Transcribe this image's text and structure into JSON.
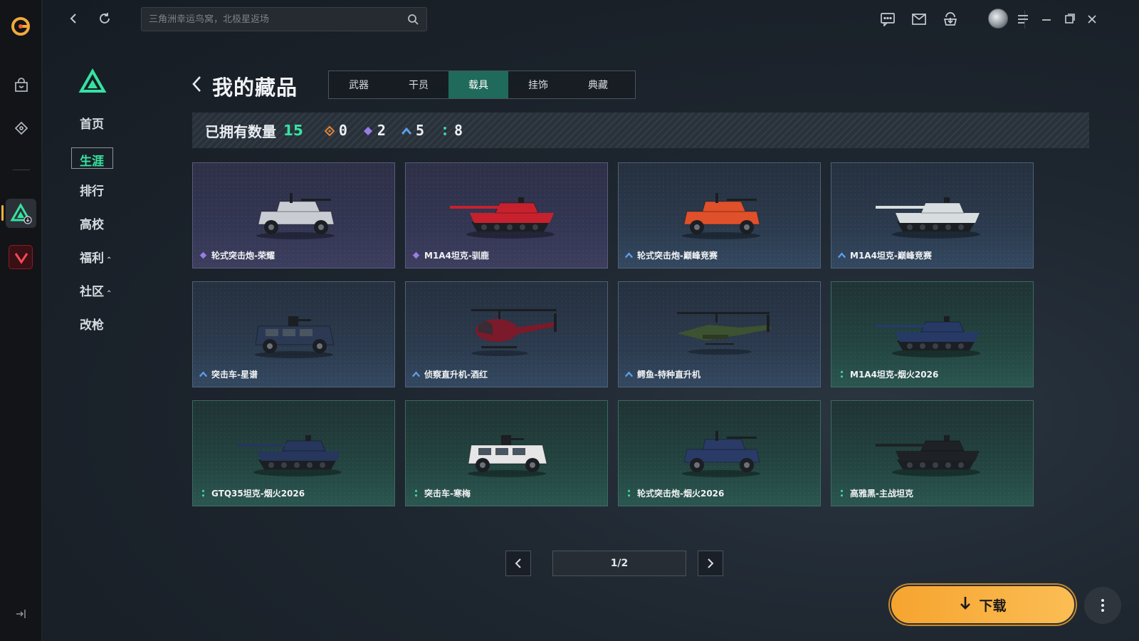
{
  "search": {
    "placeholder": "三角洲幸运鸟窝，北极星返场"
  },
  "game_nav": {
    "items": [
      {
        "label": "首页",
        "caret": ""
      },
      {
        "label": "生涯",
        "caret": ""
      },
      {
        "label": "排行",
        "caret": ""
      },
      {
        "label": "高校",
        "caret": ""
      },
      {
        "label": "福利",
        "caret": "⌃"
      },
      {
        "label": "社区",
        "caret": "⌃"
      },
      {
        "label": "改枪",
        "caret": ""
      }
    ],
    "active_index": 1
  },
  "page": {
    "title": "我的藏品",
    "tabs": [
      "武器",
      "干员",
      "载具",
      "挂饰",
      "典藏"
    ],
    "active_tab": 2
  },
  "owned": {
    "label": "已拥有数量",
    "count": "15",
    "rarities": [
      {
        "icon": "orange-diamond-icon",
        "color": "#e0843a",
        "value": "0"
      },
      {
        "icon": "purple-diamond-icon",
        "color": "#9a7be8",
        "value": "2"
      },
      {
        "icon": "blue-chevron-icon",
        "color": "#5d9ee8",
        "value": "5"
      },
      {
        "icon": "green-dots-icon",
        "color": "#3fd4a0",
        "value": "8"
      }
    ]
  },
  "cards": [
    {
      "name": "轮式突击炮-荣耀",
      "rarity": "purple",
      "vehicle": "wheeled-gun-icon",
      "body_color": "#c9ccd2"
    },
    {
      "name": "M1A4坦克-驯鹿",
      "rarity": "purple",
      "vehicle": "tank-icon",
      "body_color": "#c8212e"
    },
    {
      "name": "轮式突击炮-巅峰竞赛",
      "rarity": "blue",
      "vehicle": "wheeled-gun-icon",
      "body_color": "#e0502a"
    },
    {
      "name": "M1A4坦克-巅峰竞赛",
      "rarity": "blue",
      "vehicle": "tank-icon",
      "body_color": "#d8dde0"
    },
    {
      "name": "突击车-星谱",
      "rarity": "blue",
      "vehicle": "assault-vehicle-icon",
      "body_color": "#2c3954"
    },
    {
      "name": "侦察直升机-酒红",
      "rarity": "blue",
      "vehicle": "scout-helicopter-icon",
      "body_color": "#7a1a2a"
    },
    {
      "name": "鳄鱼-特种直升机",
      "rarity": "blue",
      "vehicle": "attack-helicopter-icon",
      "body_color": "#3d5230"
    },
    {
      "name": "M1A4坦克-烟火2026",
      "rarity": "green",
      "vehicle": "tank-icon",
      "body_color": "#273a66"
    },
    {
      "name": "GTQ35坦克-烟火2026",
      "rarity": "green",
      "vehicle": "tank-icon",
      "body_color": "#26365c"
    },
    {
      "name": "突击车-寒梅",
      "rarity": "green",
      "vehicle": "assault-vehicle-icon",
      "body_color": "#e6e6e6"
    },
    {
      "name": "轮式突击炮-烟火2026",
      "rarity": "green",
      "vehicle": "wheeled-gun-icon",
      "body_color": "#2a3b68"
    },
    {
      "name": "高雅黑-主战坦克",
      "rarity": "green",
      "vehicle": "tank-icon",
      "body_color": "#1e2226"
    }
  ],
  "pager": {
    "text": "1/2"
  },
  "download": {
    "label": "下载"
  },
  "colors": {
    "accent_green": "#36e2a0",
    "download_orange": "#f6a42f"
  }
}
